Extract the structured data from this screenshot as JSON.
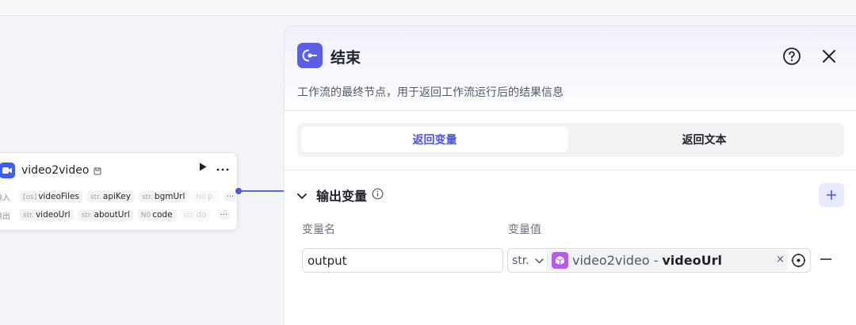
{
  "node": {
    "title": "video2video",
    "input_label": "输入",
    "output_label": "输出",
    "inputs": [
      {
        "type": "[os]",
        "name": "videoFiles"
      },
      {
        "type": "str.",
        "name": "apiKey"
      },
      {
        "type": "str.",
        "name": "bgmUrl"
      },
      {
        "type": "N0",
        "name": "p"
      }
    ],
    "outputs": [
      {
        "type": "str.",
        "name": "videoUrl"
      },
      {
        "type": "str.",
        "name": "aboutUrl"
      },
      {
        "type": "N0",
        "name": "code"
      },
      {
        "type": "str.",
        "name": "do"
      }
    ],
    "more_label": "···",
    "run_icon": "play-icon",
    "menu_icon": "more-icon"
  },
  "panel": {
    "title": "结束",
    "description": "工作流的最终节点，用于返回工作流运行后的结果信息",
    "tabs": [
      {
        "label": "返回变量",
        "active": true
      },
      {
        "label": "返回文本",
        "active": false
      }
    ],
    "section_title": "输出变量",
    "columns": {
      "name": "变量名",
      "value": "变量值"
    },
    "row": {
      "name_value": "output",
      "type": "str.",
      "ref_node": "video2video",
      "ref_separator": "-",
      "ref_var": "videoUrl",
      "clear": "×"
    }
  },
  "colors": {
    "accent": "#4d53e8",
    "panel_icon": "#5b5ee6",
    "node_badge": "#3d5cf5",
    "ref_icon": "#b75ce8"
  }
}
